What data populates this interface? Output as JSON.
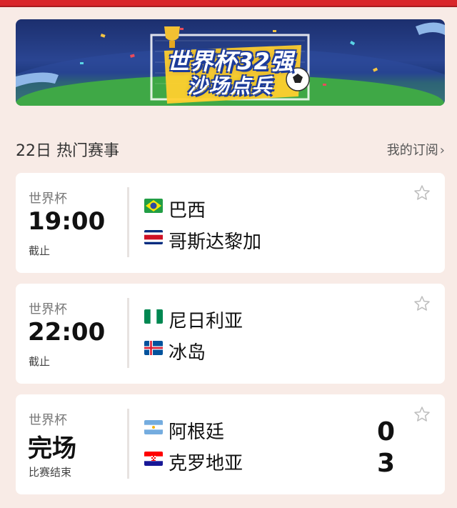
{
  "colors": {
    "accent": "#d9262b",
    "page_bg": "#f8ebe6",
    "card_bg": "#ffffff"
  },
  "banner": {
    "line1": "世界杯32强",
    "line2": "沙场点兵"
  },
  "section": {
    "title": "22日 热门赛事",
    "subscribe": "我的订阅"
  },
  "matches": [
    {
      "league": "世界杯",
      "time": "19:00",
      "status": "截止",
      "team1": {
        "name": "巴西",
        "flag": "brazil-flag"
      },
      "team2": {
        "name": "哥斯达黎加",
        "flag": "costa-rica-flag"
      }
    },
    {
      "league": "世界杯",
      "time": "22:00",
      "status": "截止",
      "team1": {
        "name": "尼日利亚",
        "flag": "nigeria-flag"
      },
      "team2": {
        "name": "冰岛",
        "flag": "iceland-flag"
      }
    },
    {
      "league": "世界杯",
      "time": "完场",
      "status": "比赛结束",
      "team1": {
        "name": "阿根廷",
        "flag": "argentina-flag",
        "score": "0"
      },
      "team2": {
        "name": "克罗地亚",
        "flag": "croatia-flag",
        "score": "3"
      }
    }
  ]
}
